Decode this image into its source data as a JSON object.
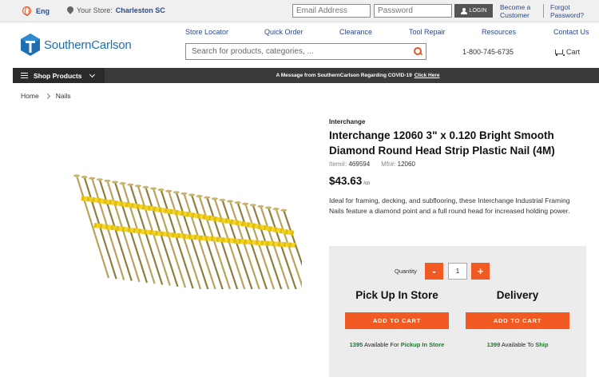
{
  "topbar": {
    "language": "Eng",
    "store_label": "Your Store:",
    "store_name": "Charleston SC",
    "email_placeholder": "Email Address",
    "password_placeholder": "Password",
    "login_label": "LOGIN",
    "become_customer_1": "Become a",
    "become_customer_2": "Customer",
    "forgot_1": "Forgot",
    "forgot_2": "Password?"
  },
  "header": {
    "logo_text": "SouthernCarlson",
    "nav": [
      "Store Locator",
      "Quick Order",
      "Clearance",
      "Tool Repair",
      "Resources",
      "Contact Us"
    ],
    "search_placeholder": "Search for products, categories, ...",
    "phone": "1-800-745-6735",
    "cart_label": "Cart"
  },
  "navbar": {
    "shop_products": "Shop Products",
    "covid_message": "A Message from SouthernCarlson Regarding COVID-19",
    "covid_link": "Click Here"
  },
  "breadcrumb": [
    "Home",
    "Nails"
  ],
  "product": {
    "brand": "Interchange",
    "title": "Interchange 12060 3\" x 0.120 Bright Smooth Diamond Round Head Strip Plastic Nail (4M)",
    "item_label": "Item#:",
    "item_number": "469594",
    "mfr_label": "Mfr#:",
    "mfr_number": "12060",
    "price": "$43.63",
    "price_unit": "/cn",
    "description": "Ideal for framing, decking, and subflooring, these Interchange Industrial Framing Nails feature a diamond point and a full round head for increased holding power."
  },
  "purchase": {
    "quantity_label": "Quantity",
    "minus": "-",
    "quantity": "1",
    "plus": "+",
    "pickup_title": "Pick Up In Store",
    "delivery_title": "Delivery",
    "add_to_cart": "ADD TO CART",
    "pickup_count": "1395",
    "pickup_text": "Available For",
    "pickup_link": "Pickup In Store",
    "ship_count": "1399",
    "ship_text": "Available To",
    "ship_link": "Ship"
  },
  "colors": {
    "accent": "#f15a22",
    "link": "#2b4a8a",
    "logo": "#1d6fb0",
    "available": "#1b7a2c"
  }
}
